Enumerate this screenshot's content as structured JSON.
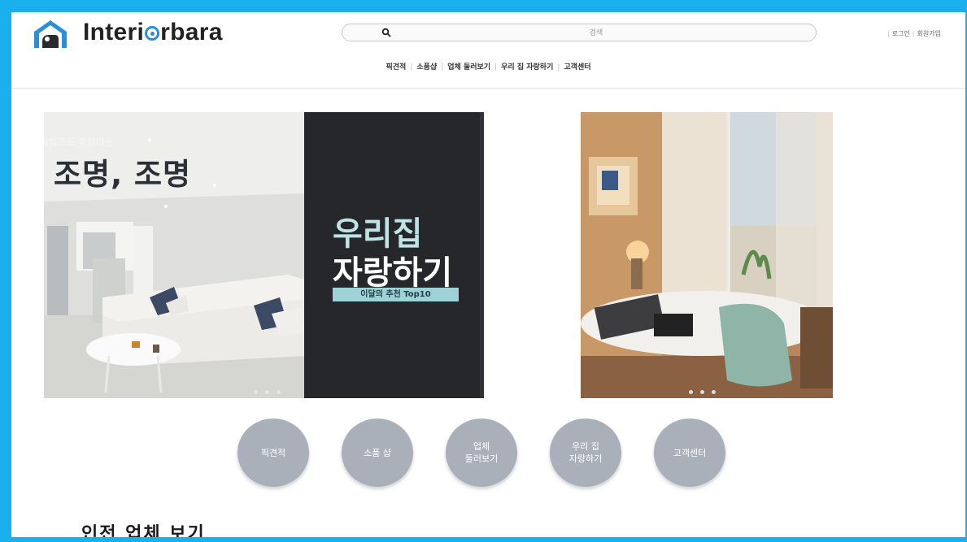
{
  "brand": {
    "name_part1": "Interi",
    "name_part2": "rbara"
  },
  "search": {
    "placeholder": "검색",
    "icon": "search-icon"
  },
  "auth": {
    "login": "로그인",
    "signup": "회원가입"
  },
  "nav": {
    "items": [
      "픽견적",
      "소품샵",
      "업체 둘러보기",
      "우리 집 자랑하기",
      "고객센터"
    ]
  },
  "banner_main": {
    "subtitle": "에뻡고도 아름다운",
    "title": "조명, 조명",
    "panel_line1": "우리집",
    "panel_line2": "자랑하기",
    "panel_tag": "이달의 추천 Top10"
  },
  "categories": [
    {
      "label": "픽견적"
    },
    {
      "label": "소품 샵"
    },
    {
      "label": "업체\n둘러보기"
    },
    {
      "label": "우리 집\n자랑하기"
    },
    {
      "label": "고객센터"
    }
  ],
  "section": {
    "title": "인전 업체 보기"
  },
  "colors": {
    "frame": "#1ab0ee",
    "accent": "#2a8fd6",
    "circle": "#a9b0ba",
    "panel": "#25272b",
    "tag": "#9fd2d6"
  }
}
